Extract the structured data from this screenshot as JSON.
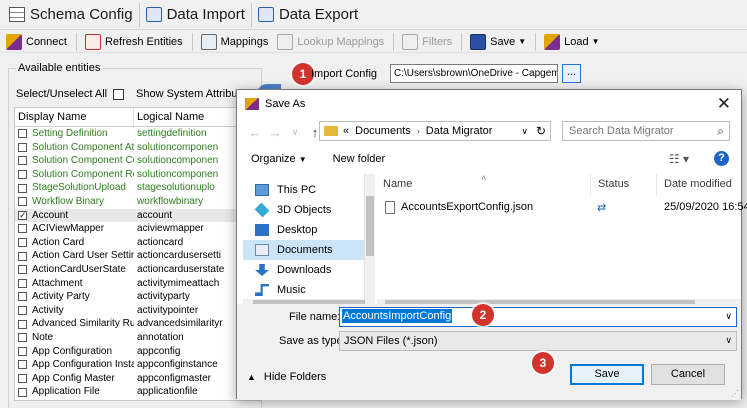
{
  "tabs": [
    {
      "label": "Schema Config",
      "icon": "grid-icon"
    },
    {
      "label": "Data Import",
      "icon": "database-icon"
    },
    {
      "label": "Data Export",
      "icon": "database-icon"
    }
  ],
  "toolbar": {
    "connect": "Connect",
    "refresh": "Refresh Entities",
    "mappings": "Mappings",
    "lookup": "Lookup Mappings",
    "filters": "Filters",
    "save": "Save",
    "load": "Load"
  },
  "left": {
    "title": "Available entities",
    "select_all": "Select/Unselect All",
    "show_system": "Show System Attributes",
    "col_display": "Display Name",
    "col_logical": "Logical Name",
    "rows": [
      {
        "d": "Setting Definition",
        "l": "settingdefinition",
        "green": true,
        "checked": false
      },
      {
        "d": "Solution Component Att...",
        "l": "solutioncomponen",
        "green": true,
        "checked": false
      },
      {
        "d": "Solution Component Co...",
        "l": "solutioncomponen",
        "green": true,
        "checked": false
      },
      {
        "d": "Solution Component Rel...",
        "l": "solutioncomponen",
        "green": true,
        "checked": false
      },
      {
        "d": "StageSolutionUpload",
        "l": "stagesolutionuplo",
        "green": true,
        "checked": false
      },
      {
        "d": "Workflow Binary",
        "l": "workflowbinary",
        "green": true,
        "checked": false
      },
      {
        "d": "Account",
        "l": "account",
        "green": false,
        "checked": true
      },
      {
        "d": "ACIViewMapper",
        "l": "aciviewmapper",
        "green": false,
        "checked": false
      },
      {
        "d": "Action Card",
        "l": "actioncard",
        "green": false,
        "checked": false
      },
      {
        "d": "Action Card User Settings",
        "l": "actioncardusersetti",
        "green": false,
        "checked": false
      },
      {
        "d": "ActionCardUserState",
        "l": "actioncarduserstate",
        "green": false,
        "checked": false
      },
      {
        "d": "Attachment",
        "l": "activitymimeattach",
        "green": false,
        "checked": false
      },
      {
        "d": "Activity Party",
        "l": "activityparty",
        "green": false,
        "checked": false
      },
      {
        "d": "Activity",
        "l": "activitypointer",
        "green": false,
        "checked": false
      },
      {
        "d": "Advanced Similarity Rule",
        "l": "advancedsimilarityr",
        "green": false,
        "checked": false
      },
      {
        "d": "Note",
        "l": "annotation",
        "green": false,
        "checked": false
      },
      {
        "d": "App Configuration",
        "l": "appconfig",
        "green": false,
        "checked": false
      },
      {
        "d": "App Configuration Insta...",
        "l": "appconfiginstance",
        "green": false,
        "checked": false
      },
      {
        "d": "App Config Master",
        "l": "appconfigmaster",
        "green": false,
        "checked": false
      },
      {
        "d": "Application File",
        "l": "applicationfile",
        "green": false,
        "checked": false
      }
    ]
  },
  "import": {
    "badge": "1",
    "label": "Import Config",
    "path": "C:\\Users\\sbrown\\OneDrive - Capgemi",
    "browse": "..."
  },
  "dialog": {
    "title": "Save As",
    "crumbs": [
      "Documents",
      "Data Migrator"
    ],
    "crumb_prefix": "«",
    "search_placeholder": "Search Data Migrator",
    "organize": "Organize",
    "new_folder": "New folder",
    "help": "?",
    "nav": [
      {
        "label": "This PC",
        "icon": "computer-icon",
        "selected": false
      },
      {
        "label": "3D Objects",
        "icon": "cube-icon",
        "selected": false
      },
      {
        "label": "Desktop",
        "icon": "desktop-icon",
        "selected": false
      },
      {
        "label": "Documents",
        "icon": "document-icon",
        "selected": true
      },
      {
        "label": "Downloads",
        "icon": "download-icon",
        "selected": false
      },
      {
        "label": "Music",
        "icon": "music-icon",
        "selected": false
      }
    ],
    "col_name": "Name",
    "col_status": "Status",
    "col_date": "Date modified",
    "files": [
      {
        "name": "AccountsExportConfig.json",
        "date": "25/09/2020 16:54"
      }
    ],
    "file_name_label": "File name:",
    "file_name_value": "AccountsImportConfig",
    "save_type_label": "Save as type:",
    "save_type_value": "JSON Files (*.json)",
    "hide_folders": "Hide Folders",
    "save_btn": "Save",
    "cancel_btn": "Cancel",
    "badge2": "2",
    "badge3": "3"
  },
  "colors": {
    "accent": "#0078d7",
    "badge": "#d0342c",
    "green_text": "#2e7d1f"
  }
}
